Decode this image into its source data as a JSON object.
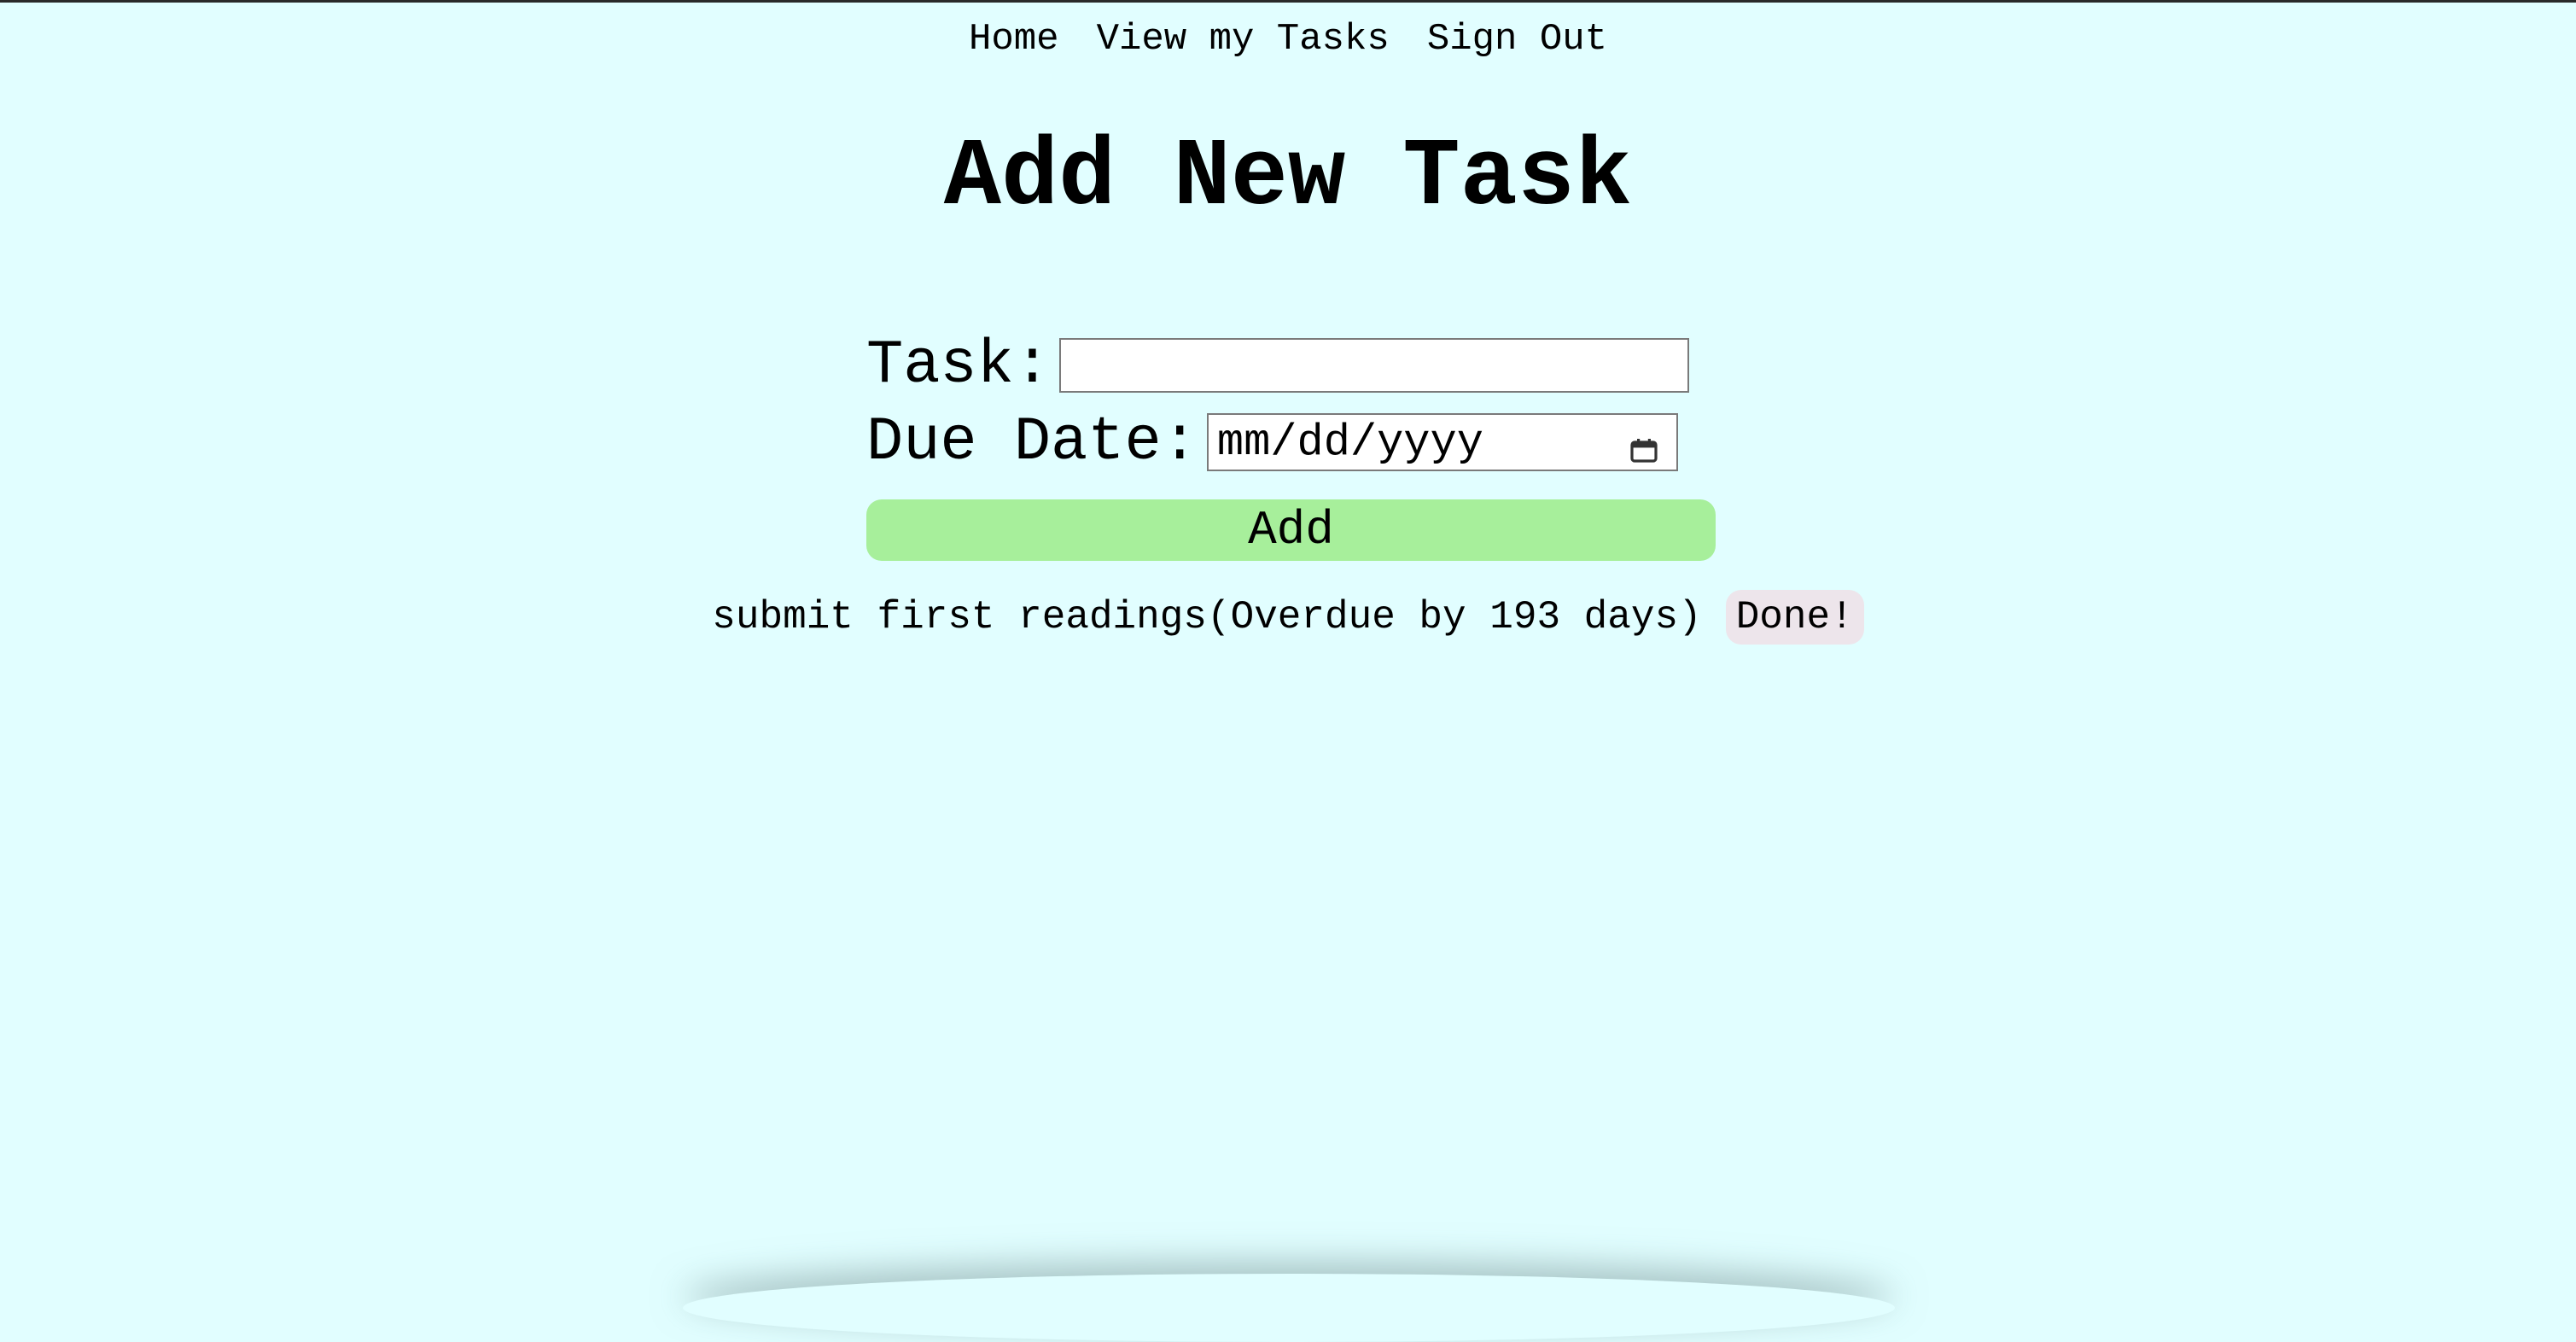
{
  "nav": {
    "home": "Home",
    "view_tasks": "View my Tasks",
    "sign_out": "Sign Out"
  },
  "page": {
    "title": "Add New Task"
  },
  "form": {
    "task_label": "Task:",
    "task_value": "",
    "due_date_label": "Due Date:",
    "due_date_placeholder": "mm/dd/yyyy",
    "calendar_icon": "calendar-icon",
    "add_label": "Add"
  },
  "tasks": [
    {
      "name": "submit first readings",
      "status": "(Overdue by 193 days)",
      "done_label": "Done!"
    }
  ],
  "colors": {
    "background": "#e1feff",
    "add_button": "#a7ef9b",
    "done_button": "#ede5eb"
  }
}
